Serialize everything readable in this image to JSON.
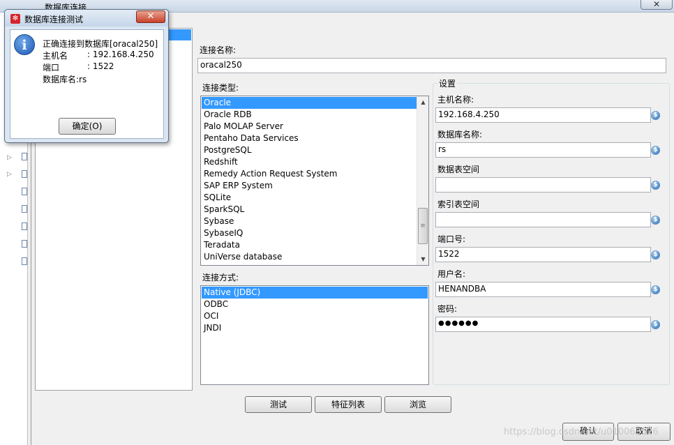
{
  "main_window": {
    "title": "数据库连接"
  },
  "connection_name": {
    "label": "连接名称:",
    "value": "oracal250"
  },
  "connection_type": {
    "label": "连接类型:",
    "items": [
      "Oracle",
      "Oracle RDB",
      "Palo MOLAP Server",
      "Pentaho Data Services",
      "PostgreSQL",
      "Redshift",
      "Remedy Action Request System",
      "SAP ERP System",
      "SQLite",
      "SparkSQL",
      "Sybase",
      "SybaseIQ",
      "Teradata",
      "UniVerse database"
    ],
    "selected": "Oracle"
  },
  "access_method": {
    "label": "连接方式:",
    "items": [
      "Native (JDBC)",
      "ODBC",
      "OCI",
      "JNDI"
    ],
    "selected": "Native (JDBC)"
  },
  "settings": {
    "title": "设置",
    "host_label": "主机名称:",
    "host_value": "192.168.4.250",
    "db_label": "数据库名称:",
    "db_value": "rs",
    "tablespace_label": "数据表空间",
    "tablespace_value": "",
    "index_label": "索引表空间",
    "index_value": "",
    "port_label": "端口号:",
    "port_value": "1522",
    "user_label": "用户名:",
    "user_value": "HENANDBA",
    "password_label": "密码:",
    "password_value": "●●●●●●",
    "var_icon": "$"
  },
  "buttons": {
    "test": "测试",
    "features": "特征列表",
    "explore": "浏览",
    "ok": "确认",
    "cancel": "取消"
  },
  "watermark": "https://blog.csdn.net/u010063526",
  "popup": {
    "title": "数据库连接测试",
    "line1": "正确连接到数据库[oracal250]",
    "host_label": "主机名",
    "host_value": ": 192.168.4.250",
    "port_label": "端口",
    "port_value": ": 1522",
    "db_line": "数据库名:rs",
    "ok_label": "确定(O)",
    "info_glyph": "i",
    "close_glyph": "✕"
  },
  "colors": {
    "selection": "#3399ff",
    "popup_close": "#c8412a"
  }
}
